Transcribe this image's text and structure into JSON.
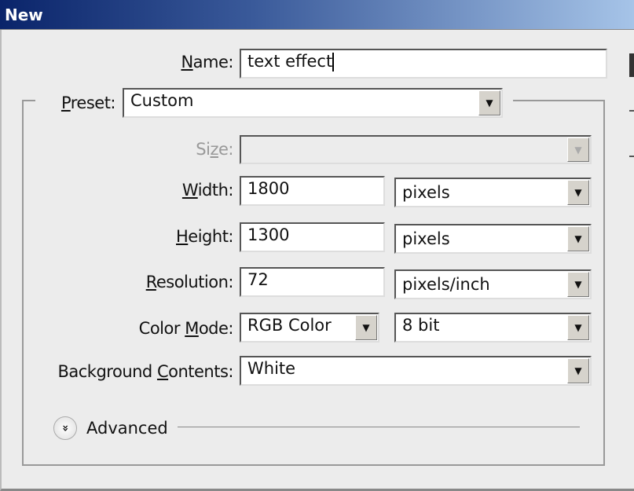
{
  "window": {
    "title": "New"
  },
  "name": {
    "label_u": "N",
    "label": "ame:",
    "value": "text effect"
  },
  "preset": {
    "label_u": "P",
    "label": "reset:",
    "value": "Custom"
  },
  "size": {
    "label_pre": "Si",
    "label_u": "z",
    "label": "e:",
    "value": ""
  },
  "width": {
    "label_u": "W",
    "label": "idth:",
    "value": "1800",
    "unit": "pixels"
  },
  "height": {
    "label_u": "H",
    "label": "eight:",
    "value": "1300",
    "unit": "pixels"
  },
  "resolution": {
    "label_u": "R",
    "label": "esolution:",
    "value": "72",
    "unit": "pixels/inch"
  },
  "color_mode": {
    "label_pre": "Color ",
    "label_u": "M",
    "label": "ode:",
    "value": "RGB Color",
    "depth": "8 bit"
  },
  "background": {
    "label_pre": "Background ",
    "label_u": "C",
    "label": "ontents:",
    "value": "White"
  },
  "advanced": {
    "label": "Advanced",
    "icon": "double-chevron-down-icon"
  }
}
